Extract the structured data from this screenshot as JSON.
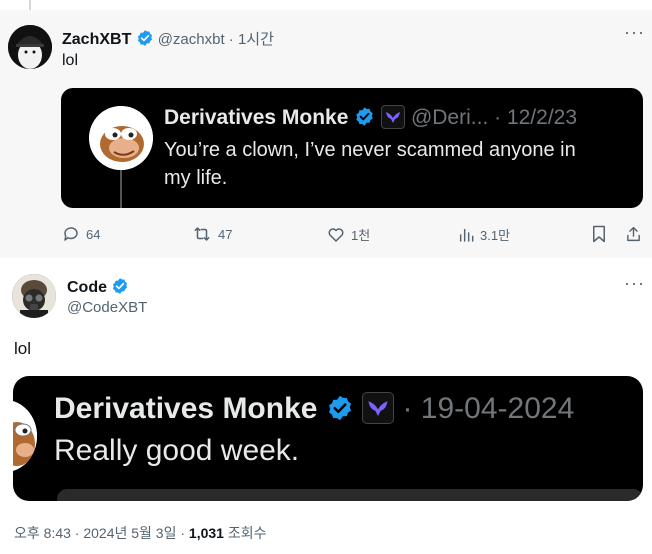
{
  "colors": {
    "verified": "#1d9bf0",
    "sky": "#7b61ff",
    "card_bg": "#000000"
  },
  "tweet1": {
    "name": "ZachXBT",
    "handle_time": "@zachxbt · 1시간",
    "text": "lol",
    "more": "···",
    "quote": {
      "name": "Derivatives Monke",
      "handle": "@Deri...",
      "date": "· 12/2/23",
      "text_line1": "You’re a clown, I’ve never scammed anyone in",
      "text_line2": "my life."
    },
    "actions": {
      "replies": "64",
      "reposts": "47",
      "likes": "1천",
      "views": "3.1만"
    }
  },
  "tweet2": {
    "name": "Code",
    "handle": "@CodeXBT",
    "text": "lol",
    "more": "···",
    "quote": {
      "name": "Derivatives Monke",
      "date": "· 19-04-2024",
      "text": "Really good week."
    },
    "footer": {
      "time": "오후 8:43 · 2024년 5월 3일 · ",
      "views": "1,031",
      "views_label": " 조회수"
    }
  }
}
